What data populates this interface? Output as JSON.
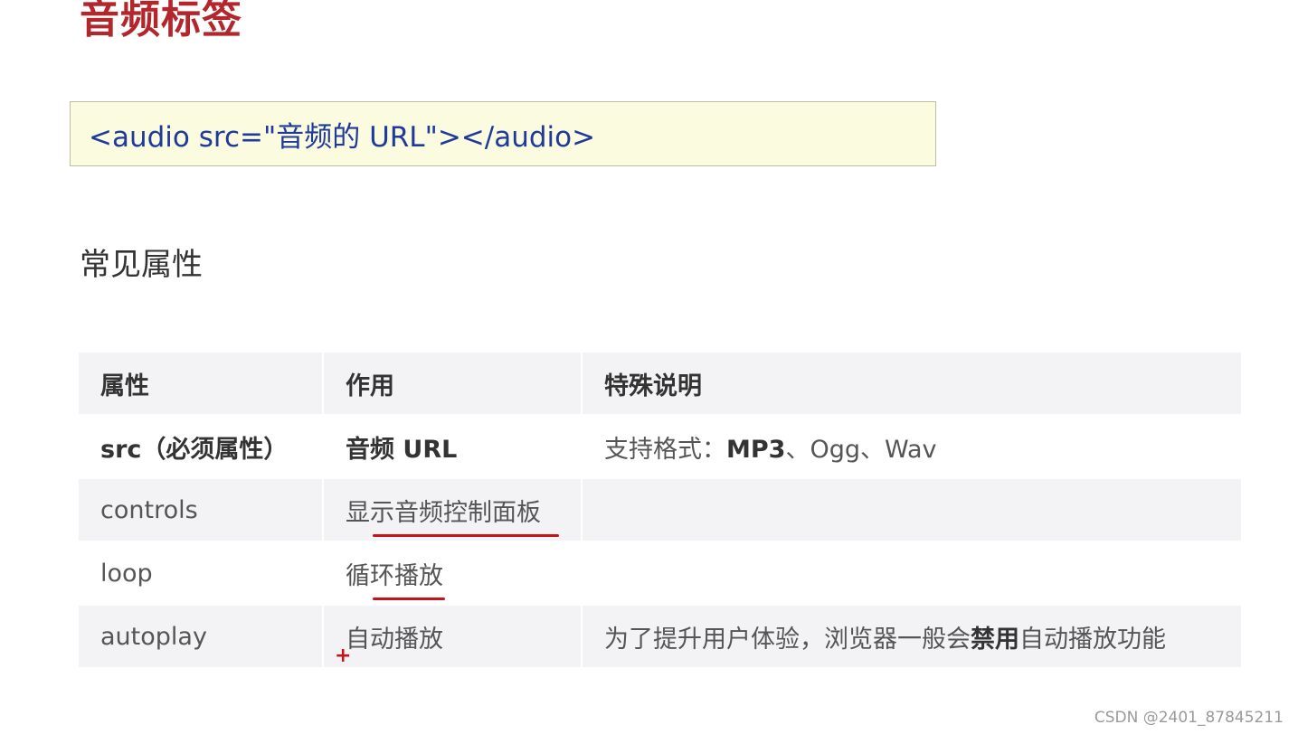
{
  "title": "音频标签",
  "code": "<audio src=\"音频的 URL\"></audio>",
  "section_title": "常见属性",
  "table": {
    "headers": [
      "属性",
      "作用",
      "特殊说明"
    ],
    "rows": [
      {
        "attr": "src（必须属性）",
        "effect": "音频 URL",
        "note_prefix": "支持格式：",
        "note_bold": "MP3",
        "note_suffix": "、Ogg、Wav"
      },
      {
        "attr": "controls",
        "effect": "显示音频控制面板",
        "note": ""
      },
      {
        "attr": "loop",
        "effect": "循环播放",
        "note": ""
      },
      {
        "attr": "autoplay",
        "effect": "自动播放",
        "note_prefix": "为了提升用户体验，浏览器一般会",
        "note_bold": "禁用",
        "note_suffix": "自动播放功能"
      }
    ]
  },
  "annotation_mark": "+",
  "watermark": "CSDN @2401_87845211",
  "colors": {
    "title": "#b3262b",
    "code_text": "#1f3a9a",
    "code_bg": "#fbfbdf",
    "underline": "#c4141b"
  }
}
